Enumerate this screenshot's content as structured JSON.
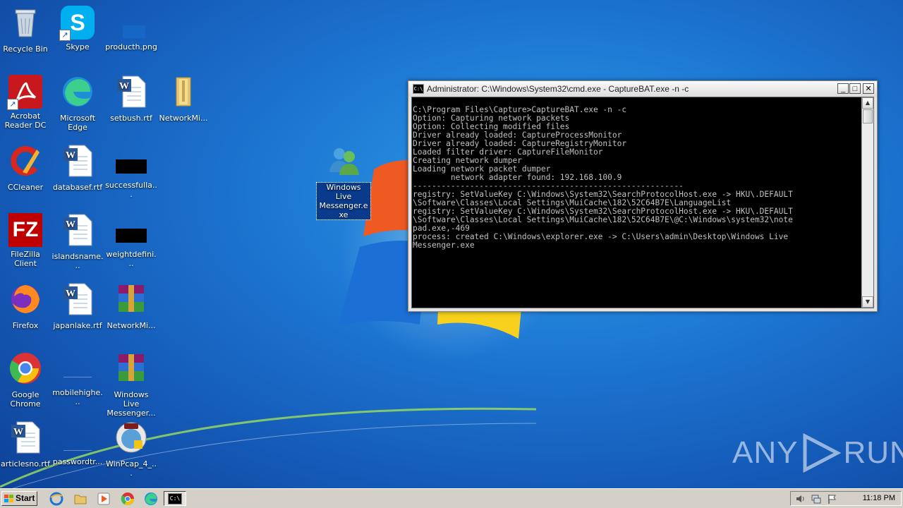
{
  "desktop": {
    "icons": [
      {
        "label": "Recycle Bin"
      },
      {
        "label": "Skype"
      },
      {
        "label": "producth.png"
      },
      {
        "label": "Acrobat Reader DC"
      },
      {
        "label": "Microsoft Edge"
      },
      {
        "label": "setbush.rtf"
      },
      {
        "label": "NetworkMi..."
      },
      {
        "label": "CCleaner"
      },
      {
        "label": "databasef.rtf"
      },
      {
        "label": "successfulla..."
      },
      {
        "label": "FileZilla Client"
      },
      {
        "label": "islandsname..."
      },
      {
        "label": "weightdefini..."
      },
      {
        "label": "Firefox"
      },
      {
        "label": "japanlake.rtf"
      },
      {
        "label": "NetworkMi..."
      },
      {
        "label": "Google Chrome"
      },
      {
        "label": "mobilehighe..."
      },
      {
        "label": "Windows Live Messenger..."
      },
      {
        "label": "articlesno.rtf"
      },
      {
        "label": "passwordtr..."
      },
      {
        "label": "WinPcap_4_..."
      },
      {
        "label": "Windows Live Messenger.exe"
      }
    ]
  },
  "cmd": {
    "title": "Administrator: C:\\Windows\\System32\\cmd.exe - CaptureBAT.exe  -n -c",
    "minimize": "_",
    "maximize": "□",
    "close": "✕",
    "output": "C:\\Program Files\\Capture>CaptureBAT.exe -n -c\nOption: Capturing network packets\nOption: Collecting modified files\nDriver already loaded: CaptureProcessMonitor\nDriver already loaded: CaptureRegistryMonitor\nLoaded filter driver: CaptureFileMonitor\nCreating network dumper\nLoading network packet dumper\n        network adapter found: 192.168.100.9\n---------------------------------------------------------\nregistry: SetValueKey C:\\Windows\\System32\\SearchProtocolHost.exe -> HKU\\.DEFAULT\n\\Software\\Classes\\Local Settings\\MuiCache\\182\\52C64B7E\\LanguageList\nregistry: SetValueKey C:\\Windows\\System32\\SearchProtocolHost.exe -> HKU\\.DEFAULT\n\\Software\\Classes\\Local Settings\\MuiCache\\182\\52C64B7E\\@C:\\Windows\\system32\\note\npad.exe,-469\nprocess: created C:\\Windows\\explorer.exe -> C:\\Users\\admin\\Desktop\\Windows Live\nMessenger.exe"
  },
  "taskbar": {
    "start_label": "Start",
    "clock": "11:18 PM"
  },
  "watermark": {
    "left": "ANY",
    "right": "RUN"
  },
  "colors": {
    "desktop": "#1d79d4",
    "selection": "#0a3a8c",
    "taskbar": "#d4d0c8"
  }
}
